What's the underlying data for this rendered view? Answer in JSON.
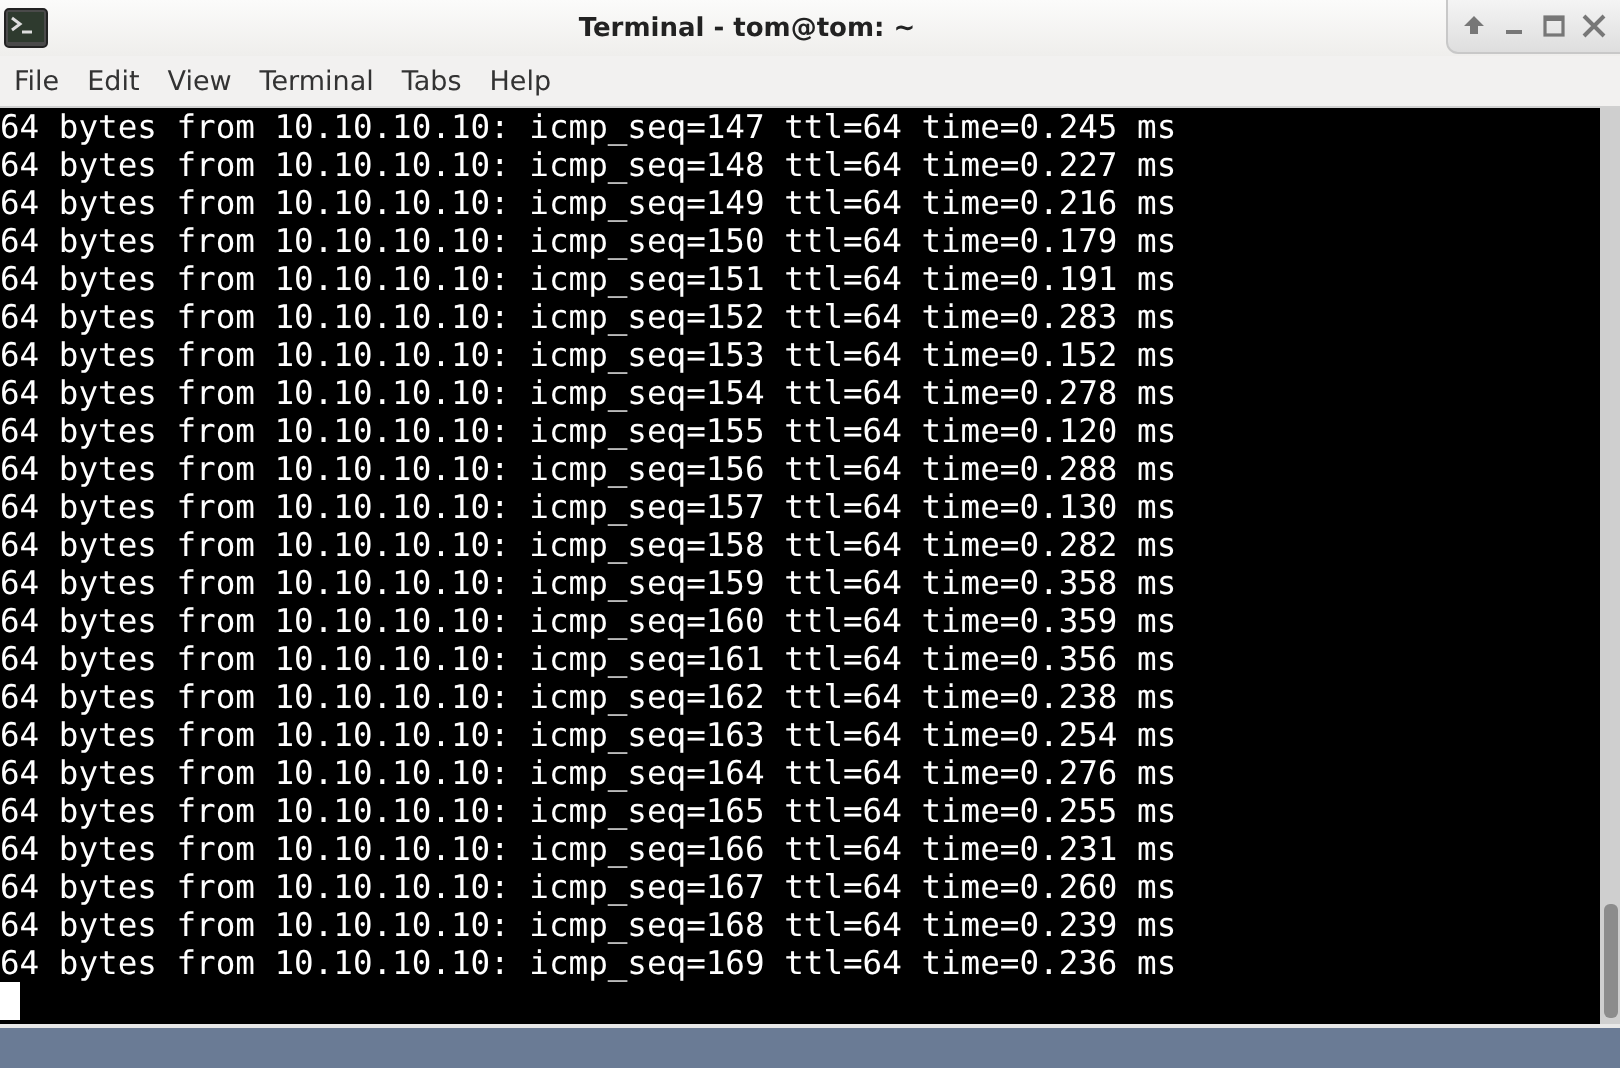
{
  "window": {
    "title": "Terminal - tom@tom: ~"
  },
  "menu": [
    "File",
    "Edit",
    "View",
    "Terminal",
    "Tabs",
    "Help"
  ],
  "terminal": {
    "lines": [
      "64 bytes from 10.10.10.10: icmp_seq=147 ttl=64 time=0.245 ms",
      "64 bytes from 10.10.10.10: icmp_seq=148 ttl=64 time=0.227 ms",
      "64 bytes from 10.10.10.10: icmp_seq=149 ttl=64 time=0.216 ms",
      "64 bytes from 10.10.10.10: icmp_seq=150 ttl=64 time=0.179 ms",
      "64 bytes from 10.10.10.10: icmp_seq=151 ttl=64 time=0.191 ms",
      "64 bytes from 10.10.10.10: icmp_seq=152 ttl=64 time=0.283 ms",
      "64 bytes from 10.10.10.10: icmp_seq=153 ttl=64 time=0.152 ms",
      "64 bytes from 10.10.10.10: icmp_seq=154 ttl=64 time=0.278 ms",
      "64 bytes from 10.10.10.10: icmp_seq=155 ttl=64 time=0.120 ms",
      "64 bytes from 10.10.10.10: icmp_seq=156 ttl=64 time=0.288 ms",
      "64 bytes from 10.10.10.10: icmp_seq=157 ttl=64 time=0.130 ms",
      "64 bytes from 10.10.10.10: icmp_seq=158 ttl=64 time=0.282 ms",
      "64 bytes from 10.10.10.10: icmp_seq=159 ttl=64 time=0.358 ms",
      "64 bytes from 10.10.10.10: icmp_seq=160 ttl=64 time=0.359 ms",
      "64 bytes from 10.10.10.10: icmp_seq=161 ttl=64 time=0.356 ms",
      "64 bytes from 10.10.10.10: icmp_seq=162 ttl=64 time=0.238 ms",
      "64 bytes from 10.10.10.10: icmp_seq=163 ttl=64 time=0.254 ms",
      "64 bytes from 10.10.10.10: icmp_seq=164 ttl=64 time=0.276 ms",
      "64 bytes from 10.10.10.10: icmp_seq=165 ttl=64 time=0.255 ms",
      "64 bytes from 10.10.10.10: icmp_seq=166 ttl=64 time=0.231 ms",
      "64 bytes from 10.10.10.10: icmp_seq=167 ttl=64 time=0.260 ms",
      "64 bytes from 10.10.10.10: icmp_seq=168 ttl=64 time=0.239 ms",
      "64 bytes from 10.10.10.10: icmp_seq=169 ttl=64 time=0.236 ms"
    ]
  }
}
